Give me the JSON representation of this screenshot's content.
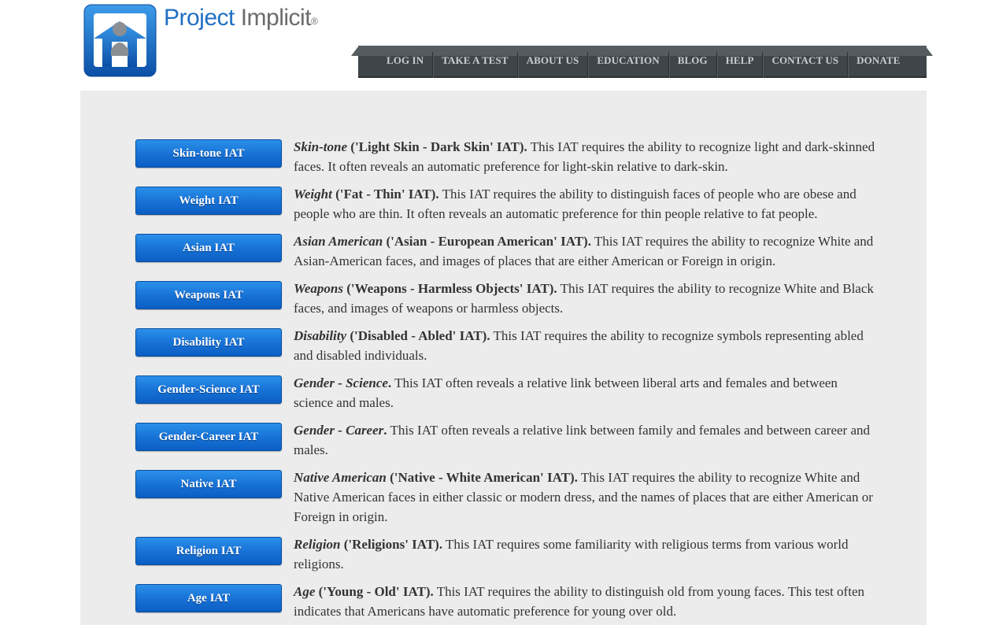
{
  "header": {
    "logo_word1": "Project",
    "logo_word2": "Implicit",
    "logo_reg": "®"
  },
  "nav": {
    "items": [
      "LOG IN",
      "TAKE A TEST",
      "ABOUT US",
      "EDUCATION",
      "BLOG",
      "HELP",
      "CONTACT US",
      "DONATE"
    ]
  },
  "tests": [
    {
      "button": "Skin-tone IAT",
      "title": "Skin-tone",
      "subtitle": " ('Light Skin - Dark Skin' IAT).",
      "text": " This IAT requires the ability to recognize light and dark-skinned faces. It often reveals an automatic preference for light-skin relative to dark-skin."
    },
    {
      "button": "Weight IAT",
      "title": "Weight",
      "subtitle": " ('Fat - Thin' IAT).",
      "text": " This IAT requires the ability to distinguish faces of people who are obese and people who are thin. It often reveals an automatic preference for thin people relative to fat people."
    },
    {
      "button": "Asian IAT",
      "title": "Asian American",
      "subtitle": " ('Asian - European American' IAT).",
      "text": " This IAT requires the ability to recognize White and Asian-American faces, and images of places that are either American or Foreign in origin."
    },
    {
      "button": "Weapons IAT",
      "title": "Weapons",
      "subtitle": " ('Weapons - Harmless Objects' IAT).",
      "text": " This IAT requires the ability to recognize White and Black faces, and images of weapons or harmless objects."
    },
    {
      "button": "Disability IAT",
      "title": "Disability",
      "subtitle": " ('Disabled - Abled' IAT).",
      "text": " This IAT requires the ability to recognize symbols representing abled and disabled individuals."
    },
    {
      "button": "Gender-Science IAT",
      "title": "Gender - Science",
      "subtitle": ".",
      "text": " This IAT often reveals a relative link between liberal arts and females and between science and males."
    },
    {
      "button": "Gender-Career IAT",
      "title": "Gender - Career",
      "subtitle": ".",
      "text": " This IAT often reveals a relative link between family and females and between career and males."
    },
    {
      "button": "Native IAT",
      "title": "Native American",
      "subtitle": " ('Native - White American' IAT).",
      "text": " This IAT requires the ability to recognize White and Native American faces in either classic or modern dress, and the names of places that are either American or Foreign in origin."
    },
    {
      "button": "Religion IAT",
      "title": "Religion",
      "subtitle": " ('Religions' IAT).",
      "text": " This IAT requires some familiarity with religious terms from various world religions."
    },
    {
      "button": "Age IAT",
      "title": "Age",
      "subtitle": " ('Young - Old' IAT).",
      "text": " This IAT requires the ability to distinguish old from young faces. This test often indicates that Americans have automatic preference for young over old."
    }
  ]
}
